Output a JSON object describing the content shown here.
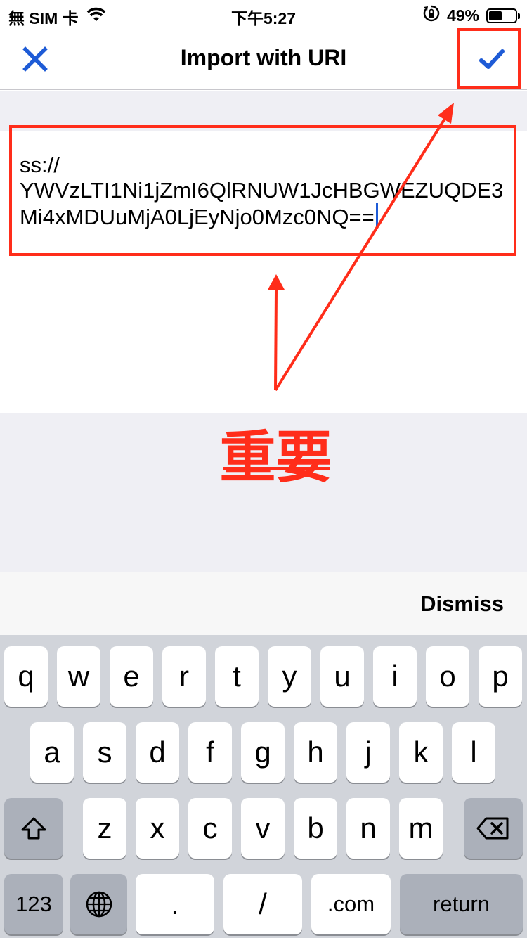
{
  "status_bar": {
    "carrier": "無 SIM 卡",
    "time": "下午5:27",
    "battery_percent": "49%",
    "battery_level": 0.49
  },
  "nav": {
    "title": "Import with URI",
    "close_icon": "close-icon",
    "confirm_icon": "checkmark-icon",
    "accent_color": "#1e5bd6"
  },
  "uri_field": {
    "value": "ss://\nYWVzLTI1Ni1jZmI6QlRNUW1JcHBGWEZUQDE3Mi4xMDUuMjA0LjEyNjo0Mzc0NQ=="
  },
  "annotation": {
    "label": "重要",
    "color": "#ff2d1a"
  },
  "accessory": {
    "dismiss_label": "Dismiss"
  },
  "keyboard": {
    "row1": [
      "q",
      "w",
      "e",
      "r",
      "t",
      "y",
      "u",
      "i",
      "o",
      "p"
    ],
    "row2": [
      "a",
      "s",
      "d",
      "f",
      "g",
      "h",
      "j",
      "k",
      "l"
    ],
    "row3": [
      "z",
      "x",
      "c",
      "v",
      "b",
      "n",
      "m"
    ],
    "shift_icon": "shift-icon",
    "delete_icon": "backspace-icon",
    "numbers_label": "123",
    "globe_icon": "globe-icon",
    "dot_label": ".",
    "slash_label": "/",
    "dotcom_label": ".com",
    "return_label": "return"
  }
}
